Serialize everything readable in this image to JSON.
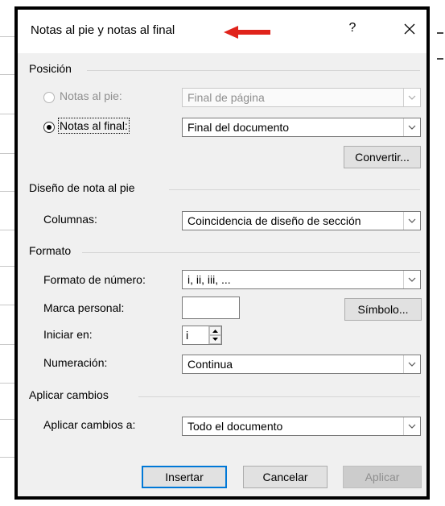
{
  "dialog": {
    "title": "Notas al pie y notas al final",
    "help": "?",
    "close": "✕"
  },
  "posicion": {
    "group_label": "Posición",
    "notas_pie": {
      "label": "Notas al pie:",
      "value": "Final de página",
      "selected": false,
      "enabled": false
    },
    "notas_final": {
      "label": "Notas al final:",
      "value": "Final del documento",
      "selected": true,
      "enabled": true
    },
    "convertir": "Convertir..."
  },
  "diseno": {
    "group_label": "Diseño de nota al pie",
    "columnas_label": "Columnas:",
    "columnas_value": "Coincidencia de diseño de sección"
  },
  "formato": {
    "group_label": "Formato",
    "formato_numero_label": "Formato de número:",
    "formato_numero_value": "i, ii, iii, ...",
    "marca_personal_label": "Marca personal:",
    "marca_personal_value": "",
    "simbolo": "Símbolo...",
    "iniciar_en_label": "Iniciar en:",
    "iniciar_en_value": "i",
    "numeracion_label": "Numeración:",
    "numeracion_value": "Continua"
  },
  "aplicar": {
    "group_label": "Aplicar cambios",
    "aplicar_a_label": "Aplicar cambios a:",
    "aplicar_a_value": "Todo el documento"
  },
  "buttons": {
    "insertar": "Insertar",
    "cancelar": "Cancelar",
    "aplicar": "Aplicar"
  },
  "colors": {
    "accent": "#0078d7",
    "arrow": "#e0231b",
    "dialog_bg": "#f0f0f0"
  }
}
